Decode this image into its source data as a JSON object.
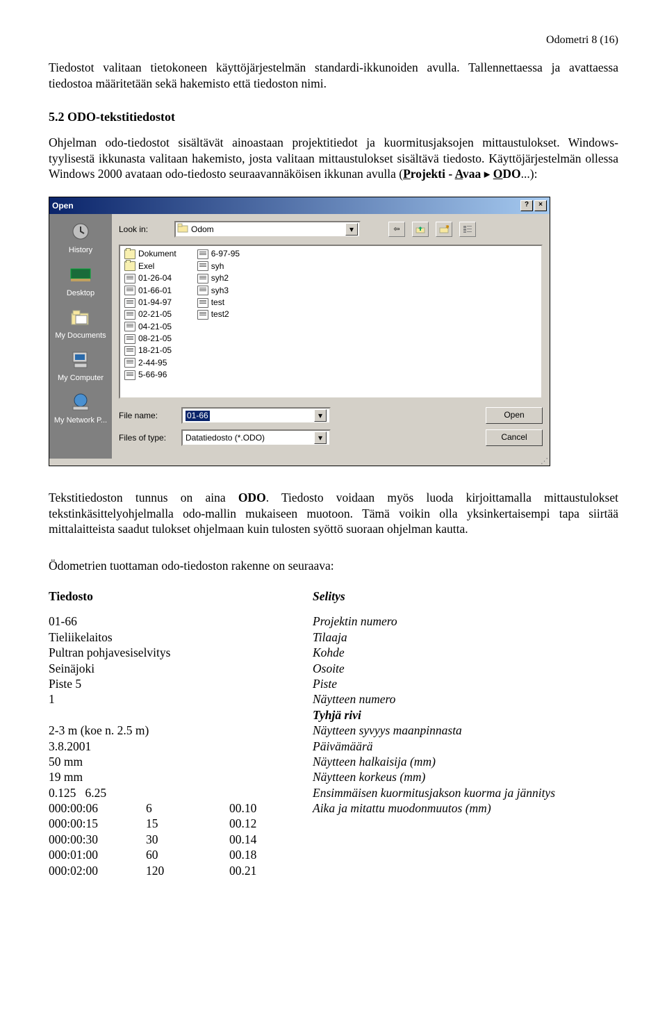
{
  "header": {
    "right": "Odometri   8 (16)"
  },
  "para1": "Tiedostot valitaan tietokoneen käyttöjärjestelmän standardi-ikkunoiden avulla. Tallennettaessa ja avattaessa tiedostoa määritetään sekä hakemisto että tiedoston nimi.",
  "section_heading": "5.2 ODO-tekstitiedostot",
  "para2a": "Ohjelman odo-tiedostot sisältävät ainoastaan projektitiedot ja kuormitusjaksojen mittaustulokset. Windows-tyylisestä ikkunasta valitaan hakemisto, josta valitaan mittaustulokset sisältävä tiedosto. Käyttöjärjestelmän ollessa Windows 2000 avataan odo-tiedosto seuraavannäköisen ikkunan avulla (",
  "menu_path": {
    "p": "P",
    "projekt": "rojekti",
    "sep": " - ",
    "a": "A",
    "vaa": "vaa",
    "arrow": " ▸ ",
    "o": "O",
    "do": "DO",
    "tail": "...):"
  },
  "dialog": {
    "title": "Open",
    "help_btn": "?",
    "close_btn": "×",
    "lookin_label": "Look in:",
    "lookin_value": "Odom",
    "places": [
      {
        "name": "history",
        "label": "History"
      },
      {
        "name": "desktop",
        "label": "Desktop"
      },
      {
        "name": "mydocuments",
        "label": "My Documents"
      },
      {
        "name": "mycomputer",
        "label": "My Computer"
      },
      {
        "name": "mynetwork",
        "label": "My Network P..."
      }
    ],
    "files_col1": [
      {
        "type": "folder",
        "label": "Dokument"
      },
      {
        "type": "folder",
        "label": "Exel"
      },
      {
        "type": "file",
        "label": "01-26-04"
      },
      {
        "type": "file",
        "label": "01-66-01"
      },
      {
        "type": "file",
        "label": "01-94-97"
      },
      {
        "type": "file",
        "label": "02-21-05"
      },
      {
        "type": "file",
        "label": "04-21-05"
      },
      {
        "type": "file",
        "label": "08-21-05"
      },
      {
        "type": "file",
        "label": "18-21-05"
      },
      {
        "type": "file",
        "label": "2-44-95"
      },
      {
        "type": "file",
        "label": "5-66-96"
      }
    ],
    "files_col2": [
      {
        "type": "file",
        "label": "6-97-95"
      },
      {
        "type": "file",
        "label": "syh"
      },
      {
        "type": "file",
        "label": "syh2"
      },
      {
        "type": "file",
        "label": "syh3"
      },
      {
        "type": "file",
        "label": "test"
      },
      {
        "type": "file",
        "label": "test2"
      }
    ],
    "filename_label": "File name:",
    "filename_value": "01-66",
    "filetype_label": "Files of type:",
    "filetype_value": "Datatiedosto (*.ODO)",
    "open_btn": "Open",
    "cancel_btn": "Cancel"
  },
  "para3": "Tekstitiedoston tunnus on aina ODO. Tiedosto voidaan myös luoda kirjoittamalla mittaustulokset tekstinkäsittelyohjelmalla odo-mallin mukaiseen muotoon. Tämä voikin olla yksinkertaisempi tapa siirtää mittalaitteista saadut tulokset ohjelmaan kuin tulosten syöttö suoraan ohjelman kautta.",
  "para3_bold": "ODO",
  "para4": "Ödometrien tuottaman odo-tiedoston rakenne on seuraava:",
  "table_heads": {
    "c1": "Tiedosto",
    "c2": "Selitys"
  },
  "structure": [
    {
      "c1": "01-66",
      "c2": "Projektin numero"
    },
    {
      "c1": "Tieliikelaitos",
      "c2": "Tilaaja"
    },
    {
      "c1": "Pultran pohjavesiselvitys",
      "c2": "Kohde"
    },
    {
      "c1": "Seinäjoki",
      "c2": "Osoite"
    },
    {
      "c1": "Piste 5",
      "c2": "Piste"
    },
    {
      "c1": "1",
      "c2": "Näytteen numero"
    },
    {
      "c1": "",
      "c2": "Tyhjä rivi",
      "bold": true
    },
    {
      "c1": "2-3 m (koe n. 2.5 m)",
      "c2": "Näytteen syvyys maanpinnasta"
    },
    {
      "c1": "3.8.2001",
      "c2": "Päivämäärä"
    },
    {
      "c1": "50 mm",
      "c2": "Näytteen halkaisija (mm)"
    },
    {
      "c1": "19 mm",
      "c2": "Näytteen korkeus (mm)"
    },
    {
      "c1": "0.125   6.25",
      "c2": "Ensimmäisen kuormitusjakson kuorma ja jännitys"
    }
  ],
  "tabular": [
    {
      "a": "000:00:06",
      "b": "6",
      "c": "00.10",
      "desc": "Aika ja mitattu muodonmuutos (mm)"
    },
    {
      "a": "000:00:15",
      "b": "15",
      "c": "00.12",
      "desc": ""
    },
    {
      "a": "000:00:30",
      "b": "30",
      "c": "00.14",
      "desc": ""
    },
    {
      "a": "000:01:00",
      "b": "60",
      "c": "00.18",
      "desc": ""
    },
    {
      "a": "000:02:00",
      "b": "120",
      "c": "00.21",
      "desc": ""
    }
  ]
}
